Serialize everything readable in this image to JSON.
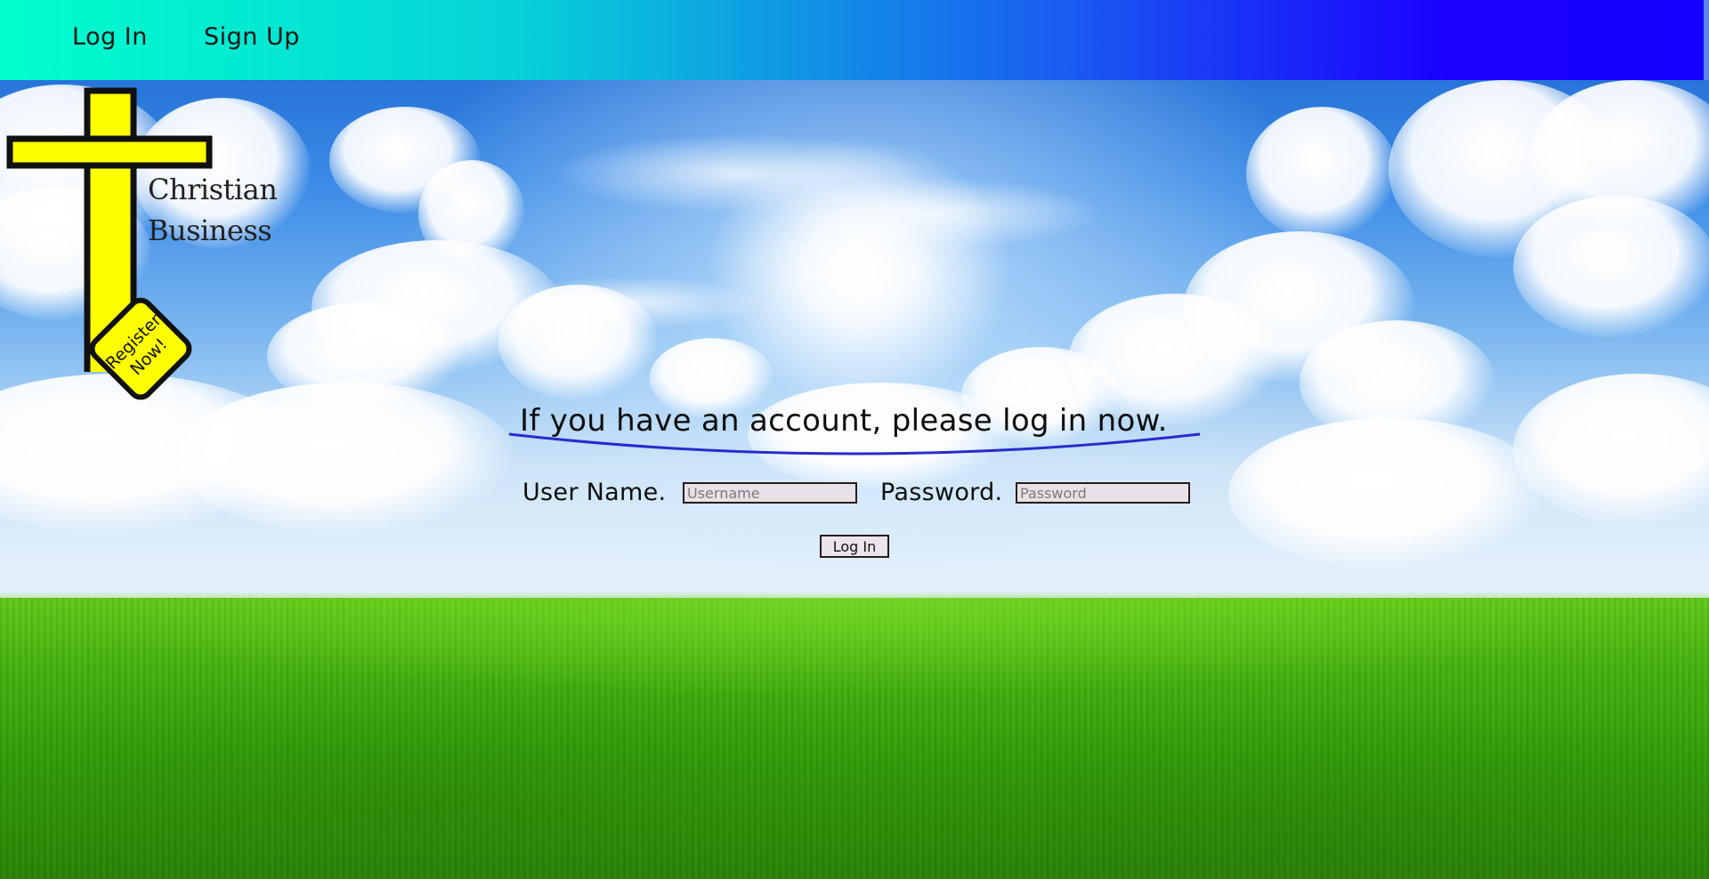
{
  "nav": {
    "login_label": "Log In",
    "signup_label": "Sign Up"
  },
  "logo": {
    "line1": "Christian",
    "line2": "Business",
    "badge_line1": "Register",
    "badge_line2": "Now!"
  },
  "login_form": {
    "heading": "If you have an account, please log in now.",
    "username_label": "User Name.",
    "username_placeholder": "Username",
    "username_value": "",
    "password_label": "Password.",
    "password_placeholder": "Password",
    "password_value": "",
    "submit_label": "Log In"
  },
  "colors": {
    "nav_gradient_start": "#00ffcc",
    "nav_gradient_end": "#1700ff",
    "cross_fill": "#ffff00",
    "cross_outline": "#111111",
    "underline": "#2a2acc"
  }
}
